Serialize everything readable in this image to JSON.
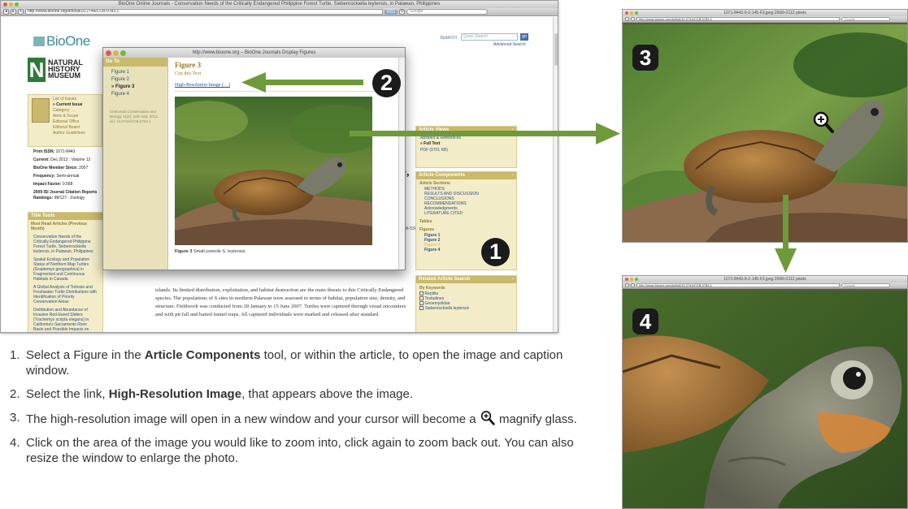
{
  "browser": {
    "window_title": "BioOne Online Journals - Conservation Needs of the Critically Endangered Philippine Forest Turtle, Siebenrockiella leytensis, in Palawan, Philippines",
    "url": "http://www.bioone.org/doi/full/10.2744/CCB-0783.1",
    "rss_label": "RSS",
    "search_engine": "Google",
    "site": {
      "logo": "BioOne",
      "search_label": "SEARCH",
      "search_placeholder": "Quick Search",
      "advanced_search": "Advanced Search",
      "museum": [
        "NATURAL",
        "HISTORY",
        "MUSEUM"
      ],
      "issue_links": [
        "List of Issues",
        "» Current Issue",
        "Category: ...",
        "Aims & Scope",
        "Editorial Office",
        "Editorial Board",
        "Author Guidelines"
      ],
      "meta": [
        {
          "label": "Print ISSN:",
          "value": "1071-8443"
        },
        {
          "label": "Current:",
          "value": "Dec 2013 : Volume 12"
        },
        {
          "label": "BioOne Member Since:",
          "value": "2007"
        },
        {
          "label": "Frequency:",
          "value": "Semi-annual"
        },
        {
          "label": "Impact Factor:",
          "value": "0.568"
        },
        {
          "label": "2009 ISI Journal Citation Reports",
          "value": ""
        },
        {
          "label": "Rankings:",
          "value": "98/127 - Zoology"
        }
      ],
      "title_tools": "Title Tools",
      "most_read": "Most Read Articles (Previous Month)",
      "most_read_items": [
        "Conservation Needs of the Critically Endangered Philippine Forest Turtle, Siebenrockiella leytensis, in Palawan, Philippines",
        "Spatial Ecology and Population Status of Northern Map Turtles (Graptemys geographica) in Fragmented and Continuous Habitats in Canada",
        "A Global Analysis of Tortoise and Freshwater Turtle Distributions with Identification of Priority Conservation Areas",
        "Distribution and Abundance of Invasive Red-Eared Sliders (Trachemys scripta elegans) in California's Sacramento River Basin and Possible Impacts on"
      ],
      "article_heading": "rtle,",
      "side_fragment": "36-5300",
      "body_text": "islands. Its limited distribution, exploitation, and habitat destruction are the main threats to this Critically Endangered species. The populations of S sites in northern Palawan were assessed in terms of habitat, population size, density, and structure. Fieldwork was conducted from 28 January to 15 June 2007. Turtles were captured through visual encounters and with pit fall and baited funnel traps. All captured individuals were marked and released after standard",
      "article_views": {
        "title": "Article Views",
        "items": [
          "Abstract & References",
          "» Full Text",
          "PDF (9701 KB)"
        ]
      },
      "article_components": {
        "title": "Article Components",
        "sections_label": "Article Sections",
        "sections": [
          "METHODS",
          "RESULTS AND DISCUSSION",
          "CONCLUSIONS",
          "RECOMMENDATIONS",
          "Acknowledgments",
          "LITERATURE CITED"
        ],
        "tables_label": "Tables",
        "figures_label": "Figures",
        "figures": [
          "Figure 1",
          "Figure 2",
          "Figure 3",
          "Figure 4"
        ]
      },
      "related_search": {
        "title": "Related Article Search",
        "by_keywords": "By Keywords",
        "keywords": [
          "Reptilia",
          "Testudines",
          "Geoemydidae",
          "Siebenrockiella leytensis"
        ]
      }
    }
  },
  "popup": {
    "window_title": "http://www.bioone.org – BioOne Journals Display Figures",
    "goto_label": "Go To",
    "goto_items": [
      "Figure 1",
      "Figure 2",
      "» Figure 3",
      "Figure 4"
    ],
    "citation": "Chelonian Conservation and Biology 11(2): 149–153. 2012. doi: 10.2744/CCB-0783.1",
    "figure_title": "Figure 3",
    "cite_link": "Cite this Text",
    "hires_link": "High-Resolution Image (…)",
    "caption_bold": "Figure 3",
    "caption": "Small juvenile S. leytensis."
  },
  "badges": [
    "1",
    "2",
    "3",
    "4"
  ],
  "hires_windows": [
    {
      "title": "1071-8443-9-2-145-F3.jpeg 2968×2112 pixels",
      "url": "http://www.bioone.org/doi/full/10.2744/CCB-0783.1"
    },
    {
      "title": "1071-8443-9-2-145-F3.jpeg 2968×2112 pixels",
      "url": "http://www.bioone.org/doi/full/10.2744/CCB-0783.1"
    }
  ],
  "instructions": [
    {
      "num": "1.",
      "pre": "Select a Figure in the ",
      "bold": "Article Components",
      "post": " tool, or within the article, to open the image and caption window."
    },
    {
      "num": "2.",
      "pre": "Select the link, ",
      "bold": "High-Resolution Image",
      "post": ", that appears above the image."
    },
    {
      "num": "3.",
      "pre": "The high-resolution image will open in a new window and your cursor will become a ",
      "bold": "",
      "post": " magnify glass."
    },
    {
      "num": "4.",
      "pre": "Click on the area of the image you would like to zoom into, click again to zoom back out. You can also resize the window to enlarge the photo.",
      "bold": "",
      "post": ""
    }
  ],
  "colors": {
    "accent": "#6f9a3a",
    "badge": "#1b1b1b",
    "gold": "#c9b96a"
  },
  "icons": [
    "magnify-plus-icon",
    "arrow-right-icon",
    "arrow-down-icon",
    "arrow-left-icon"
  ]
}
